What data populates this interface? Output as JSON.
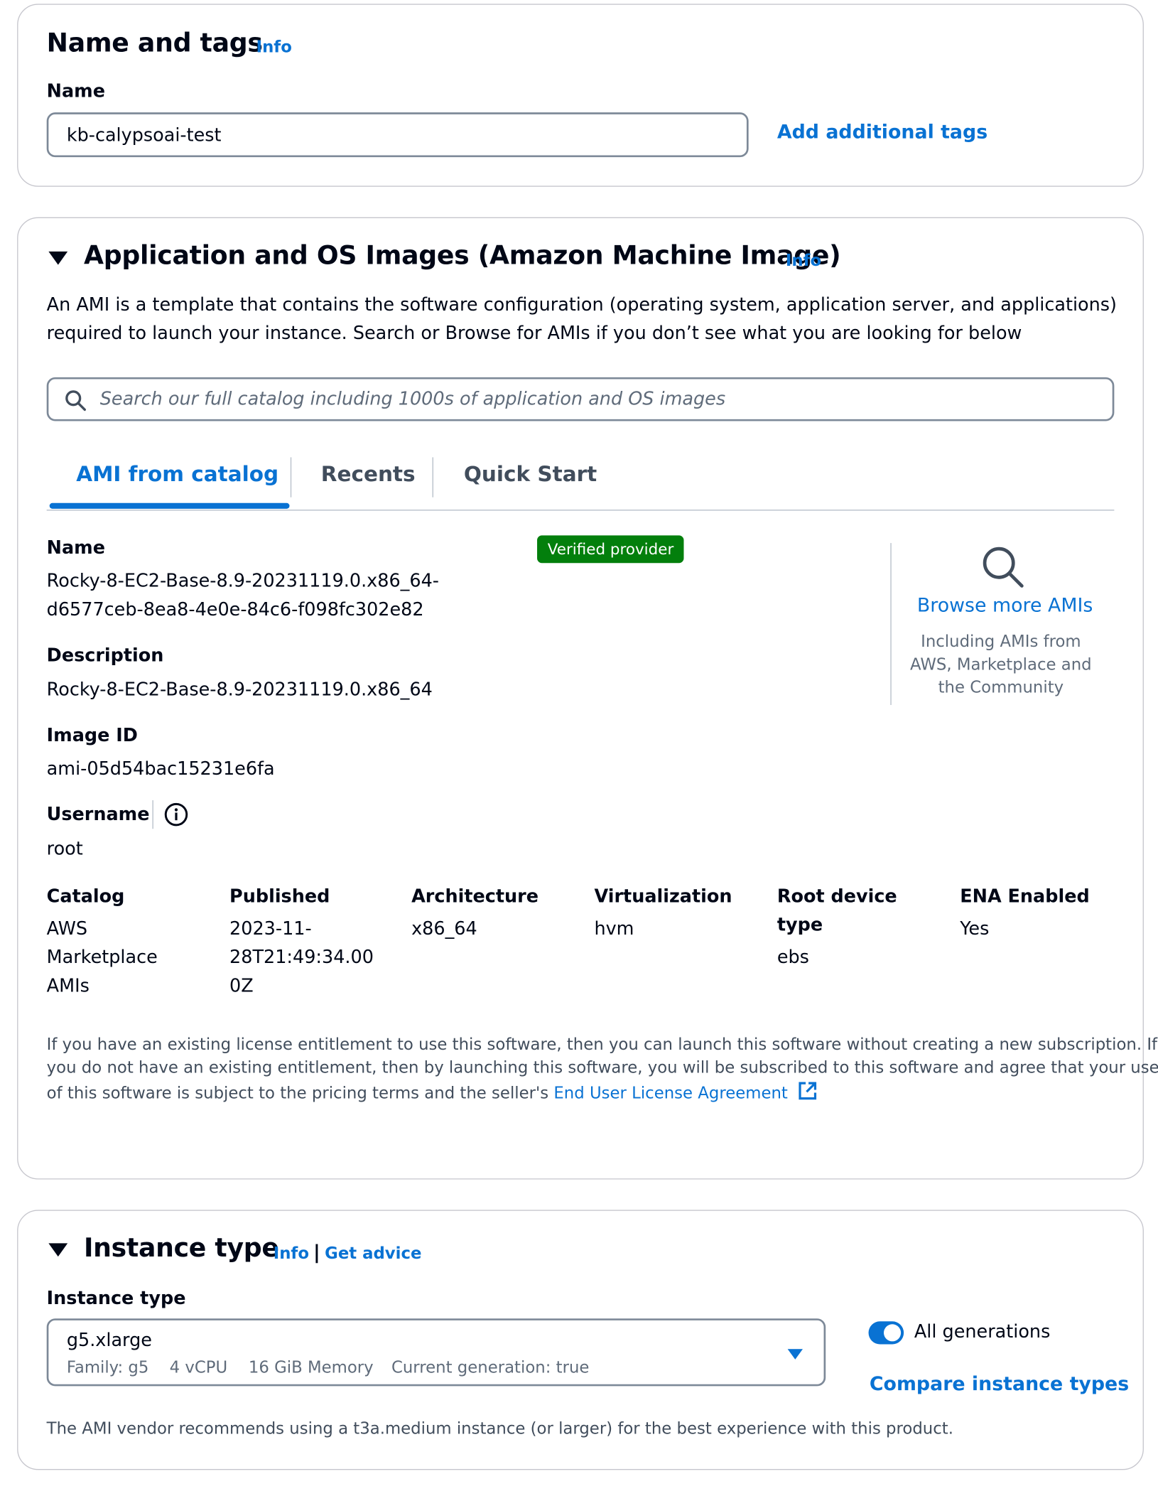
{
  "name_tags": {
    "title": "Name and tags",
    "info": "Info",
    "name_label": "Name",
    "name_value": "kb-calypsoai-test",
    "add_tags_link": "Add additional tags"
  },
  "ami": {
    "title": "Application and OS Images (Amazon Machine Image)",
    "info": "Info",
    "description_line1": "An AMI is a template that contains the software configuration (operating system, application server, and applications)",
    "description_line2": "required to launch your instance. Search or Browse for AMIs if you don’t see what you are looking for below",
    "search_placeholder": "Search our full catalog including 1000s of application and OS images",
    "tabs": [
      {
        "label": "AMI from catalog",
        "active": true
      },
      {
        "label": "Recents",
        "active": false
      },
      {
        "label": "Quick Start",
        "active": false
      }
    ],
    "name_label": "Name",
    "name_line1": "Rocky-8-EC2-Base-8.9-20231119.0.x86_64-",
    "name_line2": "d6577ceb-8ea8-4e0e-84c6-f098fc302e82",
    "badge": "Verified provider",
    "description_label": "Description",
    "description_value": "Rocky-8-EC2-Base-8.9-20231119.0.x86_64",
    "image_id_label": "Image ID",
    "image_id_value": "ami-05d54bac15231e6fa",
    "username_label": "Username",
    "username_value": "root",
    "browse_link": "Browse more AMIs",
    "browse_desc_line1": "Including AMIs from",
    "browse_desc_line2": "AWS, Marketplace and",
    "browse_desc_line3": "the Community",
    "columns": {
      "catalog_label": "Catalog",
      "catalog_value": [
        "AWS",
        "Marketplace",
        "AMIs"
      ],
      "published_label": "Published",
      "published_value": [
        "2023-11-",
        "28T21:49:34.00",
        "0Z"
      ],
      "architecture_label": "Architecture",
      "architecture_value": "x86_64",
      "virtualization_label": "Virtualization",
      "virtualization_value": "hvm",
      "root_device_label": [
        "Root device",
        "type"
      ],
      "root_device_value": "ebs",
      "ena_label": "ENA Enabled",
      "ena_value": "Yes"
    },
    "license_line1": "If you have an existing license entitlement to use this software, then you can launch this software without creating a new subscription. If",
    "license_line2": "you do not have an existing entitlement, then by launching this software, you will be subscribed to this software and agree that your use",
    "license_line3": "of this software is subject to the pricing terms and the seller's ",
    "eula_link": "End User License Agreement"
  },
  "instance_type": {
    "title": "Instance type",
    "info": "Info",
    "separator": "|",
    "get_advice": "Get advice",
    "field_label": "Instance type",
    "selected": "g5.xlarge",
    "family": "Family: g5",
    "vcpu": "4 vCPU",
    "memory": "16 GiB Memory",
    "current_gen": "Current generation: true",
    "all_generations_label": "All generations",
    "all_generations_on": true,
    "compare_link": "Compare instance types",
    "vendor_note": "The AMI vendor recommends using a t3a.medium instance (or larger) for the best experience with this product."
  },
  "colors": {
    "link_blue": "#0972d3",
    "verified_green": "#037f0c",
    "border_gray": "#c6c6cd"
  },
  "icons": [
    "search-icon",
    "magnifier-icon",
    "info-circle-icon",
    "external-link-icon",
    "caret-down-icon",
    "expand-triangle-icon"
  ]
}
